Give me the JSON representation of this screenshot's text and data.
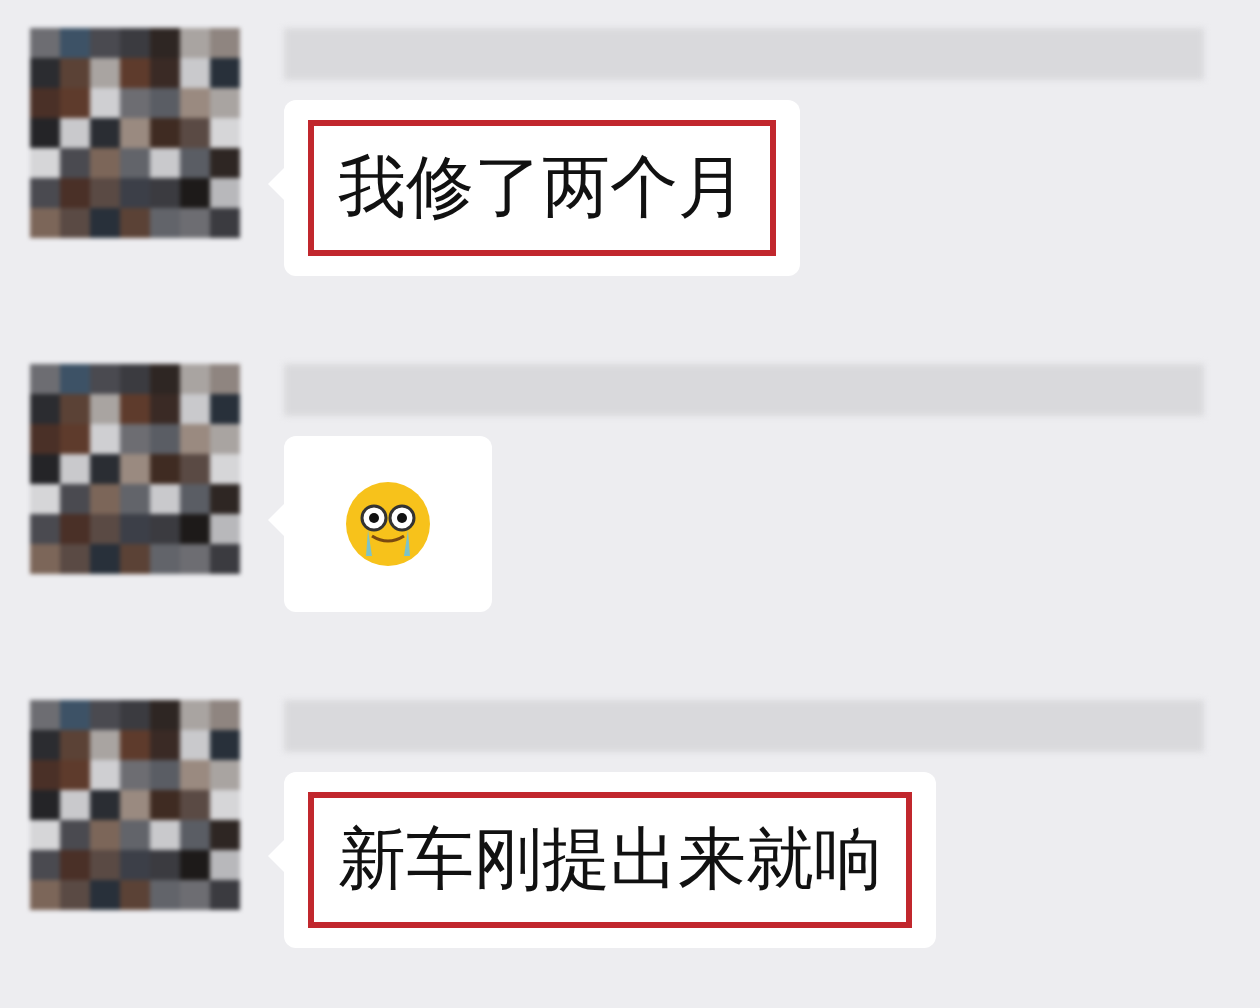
{
  "messages": [
    {
      "kind": "text",
      "text": "我修了两个月",
      "highlighted": true
    },
    {
      "kind": "emoji",
      "highlighted": false
    },
    {
      "kind": "text",
      "text": "新车刚提出来就响",
      "highlighted": true
    }
  ]
}
